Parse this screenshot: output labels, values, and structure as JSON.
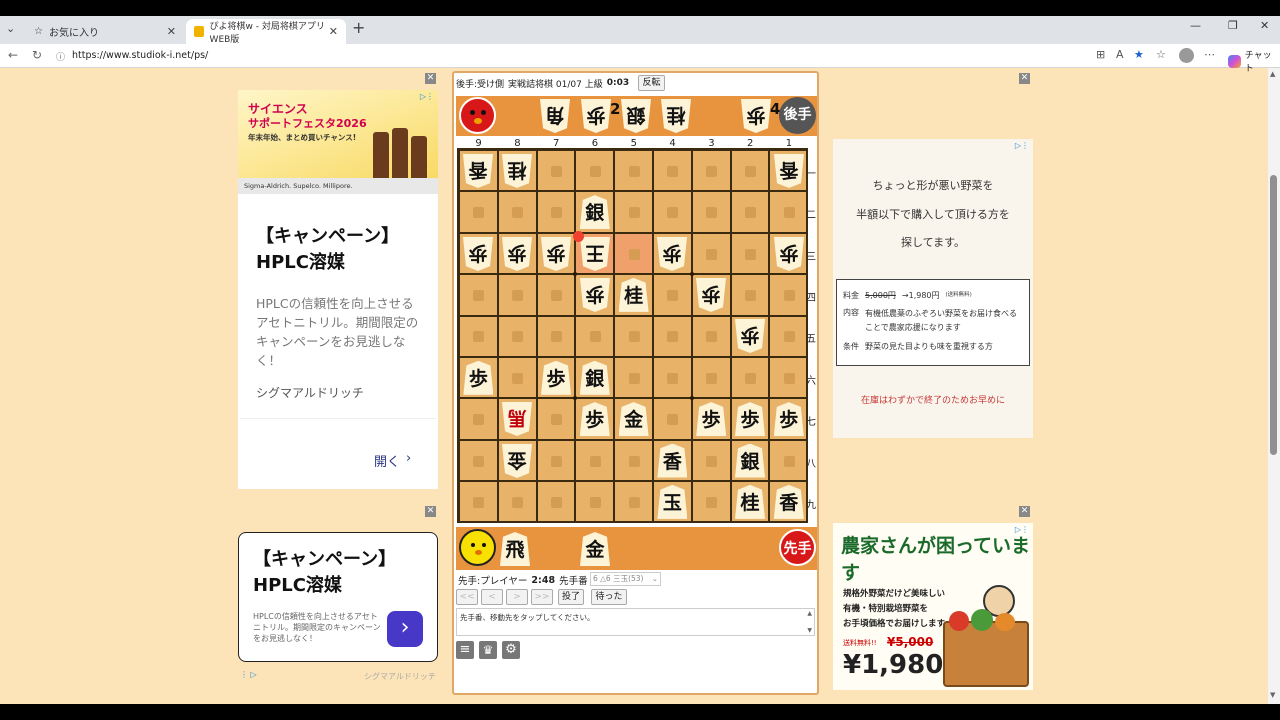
{
  "browser": {
    "tab1_title": "お気に入り",
    "tab2_title": "ぴよ将棋w - 対局将棋アプリ WEB版",
    "url": "https://www.studiok-i.net/ps/",
    "copilot_label": "チャット"
  },
  "ad_left_top": {
    "banner_line1": "サイエンス",
    "banner_line2": "サポートフェスタ2026",
    "banner_line3": "年末年始、まとめ買いチャンス!",
    "banner_brands": "Sigma-Aldrich. Supelco. Millipore.",
    "headline": "【キャンペーン】HPLC溶媒",
    "body": "HPLCの信頼性を向上させるアセトニトリル。期間限定のキャンペーンをお見逃しなく！",
    "advertiser": "シグマアルドリッチ",
    "open_label": "開く"
  },
  "ad_left_bottom": {
    "headline": "【キャンペーン】HPLC溶媒",
    "body": "HPLCの信頼性を向上させるアセトニトリル。期間限定のキャンペーンをお見逃しなく！",
    "advertiser": "シグマアルドリッチ"
  },
  "ad_right_top": {
    "line1": "ちょっと形が悪い野菜を",
    "line2": "半額以下で購入して頂ける方を",
    "line3": "探してます。",
    "price_label": "料金",
    "price_old": "5,000円",
    "price_new": "→1,980円",
    "price_note": "(送料無料)",
    "content_label": "内容",
    "content_text": "有機低農薬のふぞろい野菜をお届け食べることで農家応援になります",
    "cond_label": "条件",
    "cond_text": "野菜の見た目よりも味を重視する方",
    "footer": "在庫はわずかで終了のためお早めに"
  },
  "ad_right_bottom": {
    "title": "農家さんが困っています",
    "line1": "規格外野菜だけど美味しい",
    "line2": "有機・特別栽培野菜を",
    "line3": "お手頃価格でお届けします。",
    "shipping": "送料無料!!",
    "old_price": "¥5,000",
    "new_price": "¥1,980"
  },
  "game": {
    "header_player": "後手:受け側",
    "header_mode": "実戦詰将棋 01/07 上級",
    "header_time": "0:03",
    "flip_label": "反転",
    "gote_label": "後手",
    "sente_label": "先手",
    "file_labels": [
      "9",
      "8",
      "7",
      "6",
      "5",
      "4",
      "3",
      "2",
      "1"
    ],
    "rank_labels": [
      "一",
      "二",
      "三",
      "四",
      "五",
      "六",
      "七",
      "八",
      "九"
    ],
    "gote_hand": [
      {
        "p": "角",
        "n": ""
      },
      {
        "p": "歩",
        "n": "2"
      },
      {
        "p": "銀",
        "n": ""
      },
      {
        "p": "桂",
        "n": ""
      },
      {
        "p": "歩",
        "n": "4"
      }
    ],
    "sente_hand": [
      "飛",
      "金"
    ],
    "footer_player": "先手:プレイヤー",
    "footer_time": "2:48",
    "footer_turn": "先手番",
    "move_select": "6 △6 三玉(53)",
    "nav_first": "<<",
    "nav_prev": "<",
    "nav_next": ">",
    "nav_last": ">>",
    "resign_label": "投了",
    "undo_label": "待った",
    "message": "先手番、移動先をタップしてください。",
    "pieces": [
      {
        "f": 9,
        "r": 1,
        "p": "香",
        "g": true
      },
      {
        "f": 8,
        "r": 1,
        "p": "桂",
        "g": true
      },
      {
        "f": 1,
        "r": 1,
        "p": "香",
        "g": true
      },
      {
        "f": 6,
        "r": 2,
        "p": "銀",
        "g": false
      },
      {
        "f": 9,
        "r": 3,
        "p": "歩",
        "g": true
      },
      {
        "f": 8,
        "r": 3,
        "p": "歩",
        "g": true
      },
      {
        "f": 7,
        "r": 3,
        "p": "歩",
        "g": true
      },
      {
        "f": 6,
        "r": 3,
        "p": "王",
        "g": true
      },
      {
        "f": 4,
        "r": 3,
        "p": "歩",
        "g": true
      },
      {
        "f": 1,
        "r": 3,
        "p": "歩",
        "g": true
      },
      {
        "f": 6,
        "r": 4,
        "p": "歩",
        "g": true
      },
      {
        "f": 5,
        "r": 4,
        "p": "桂",
        "g": false
      },
      {
        "f": 3,
        "r": 4,
        "p": "歩",
        "g": true
      },
      {
        "f": 2,
        "r": 5,
        "p": "歩",
        "g": true
      },
      {
        "f": 9,
        "r": 6,
        "p": "歩",
        "g": false
      },
      {
        "f": 7,
        "r": 6,
        "p": "歩",
        "g": false
      },
      {
        "f": 6,
        "r": 6,
        "p": "銀",
        "g": false
      },
      {
        "f": 8,
        "r": 7,
        "p": "馬",
        "g": true,
        "red": true
      },
      {
        "f": 6,
        "r": 7,
        "p": "歩",
        "g": false
      },
      {
        "f": 5,
        "r": 7,
        "p": "金",
        "g": false
      },
      {
        "f": 3,
        "r": 7,
        "p": "歩",
        "g": false
      },
      {
        "f": 2,
        "r": 7,
        "p": "歩",
        "g": false
      },
      {
        "f": 1,
        "r": 7,
        "p": "歩",
        "g": false
      },
      {
        "f": 8,
        "r": 8,
        "p": "金",
        "g": true
      },
      {
        "f": 4,
        "r": 8,
        "p": "香",
        "g": false
      },
      {
        "f": 2,
        "r": 8,
        "p": "銀",
        "g": false
      },
      {
        "f": 4,
        "r": 9,
        "p": "玉",
        "g": false
      },
      {
        "f": 2,
        "r": 9,
        "p": "桂",
        "g": false
      },
      {
        "f": 1,
        "r": 9,
        "p": "香",
        "g": false
      }
    ]
  },
  "colors": {
    "board": "#e8b369",
    "hand_zone": "#e8943f",
    "ad_bg": "#fde4b8",
    "accent_red": "#c0000c"
  }
}
